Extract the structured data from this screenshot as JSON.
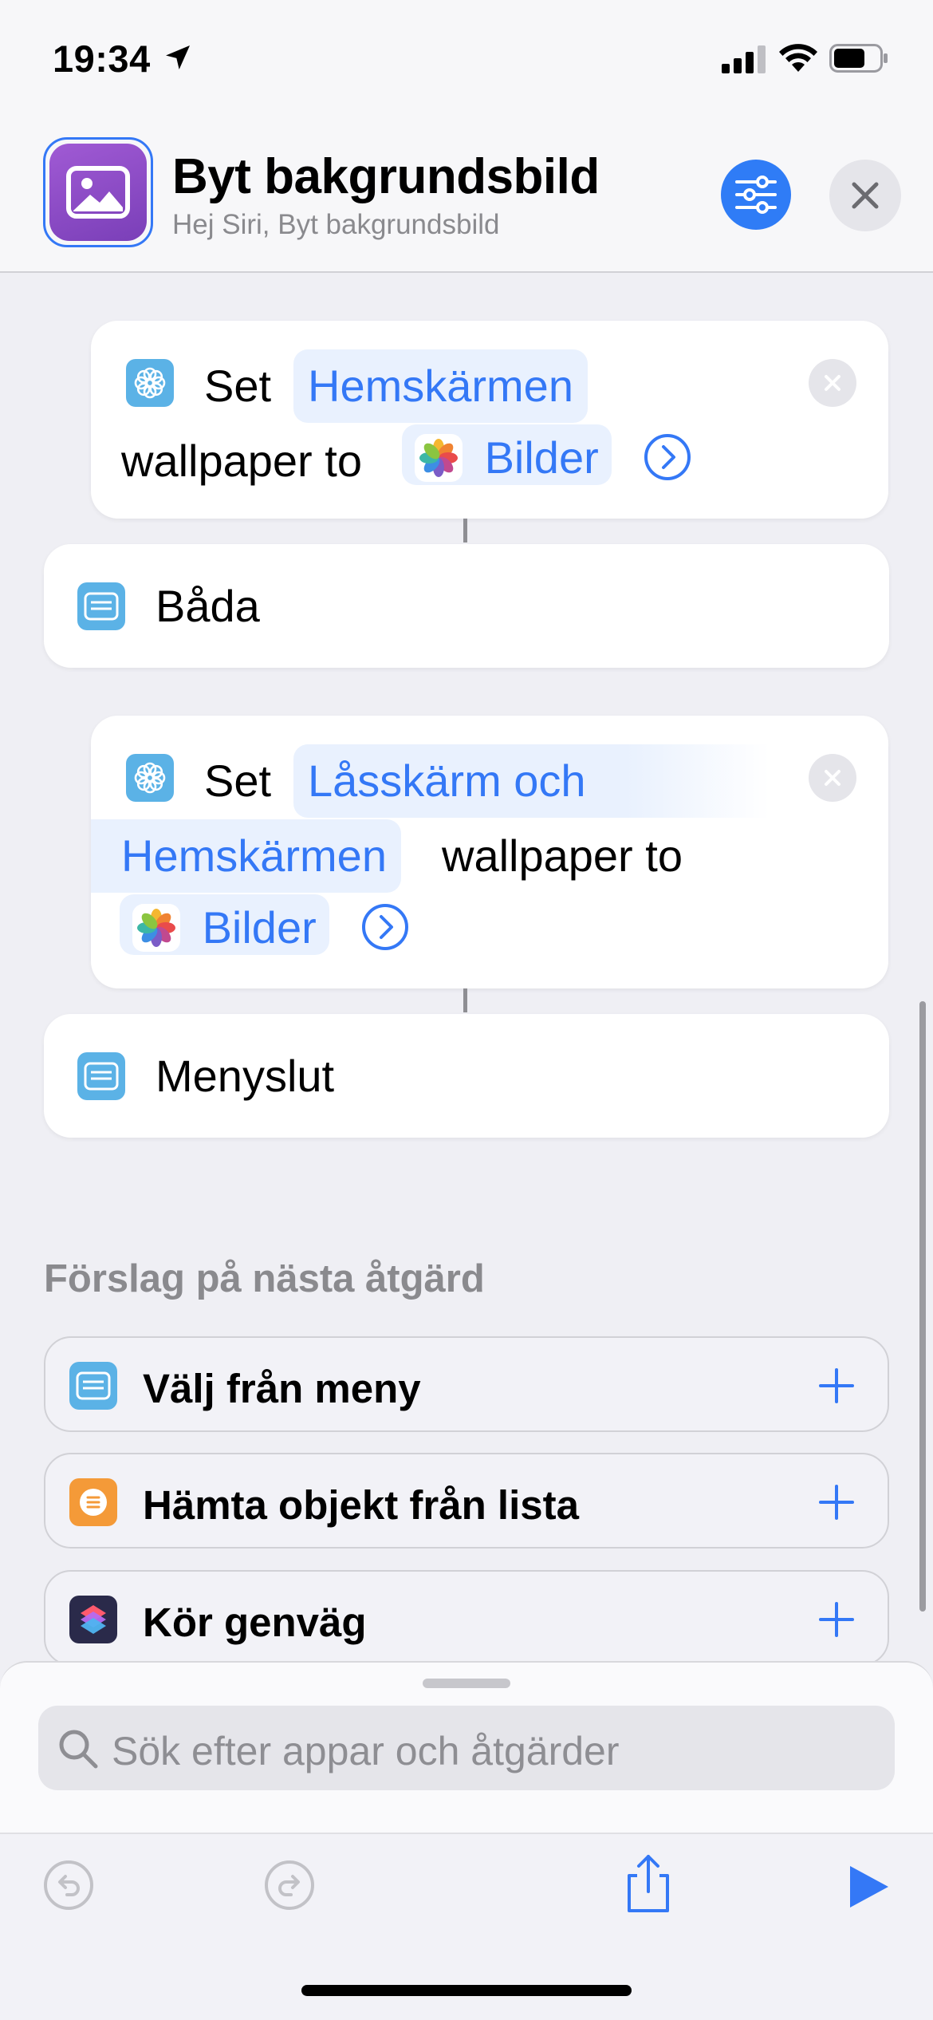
{
  "status_bar": {
    "time": "19:34"
  },
  "header": {
    "title": "Byt bakgrundsbild",
    "subtitle": "Hej Siri, Byt bakgrundsbild"
  },
  "actions": [
    {
      "set_label": "Set",
      "location": "Hemskärmen",
      "middle": "wallpaper to",
      "photos": "Bilder"
    },
    {
      "menu_label": "Båda"
    },
    {
      "set_label": "Set",
      "location_line1": "Låsskärm och",
      "location_line2": "Hemskärmen",
      "middle": "wallpaper to",
      "photos": "Bilder"
    },
    {
      "menu_label": "Menyslut"
    }
  ],
  "suggestions": {
    "title": "Förslag på nästa åtgärd",
    "items": [
      {
        "label": "Välj från meny",
        "icon": "menu-icon",
        "color": "#5bb2e6"
      },
      {
        "label": "Hämta objekt från lista",
        "icon": "list-icon",
        "color": "#f49a38"
      },
      {
        "label": "Kör genväg",
        "icon": "shortcuts-icon",
        "color": "#2a2a4a"
      }
    ]
  },
  "search": {
    "placeholder": "Sök efter appar och åtgärder"
  },
  "colors": {
    "accent": "#3478f6",
    "pill_bg": "#e9f1fe"
  }
}
